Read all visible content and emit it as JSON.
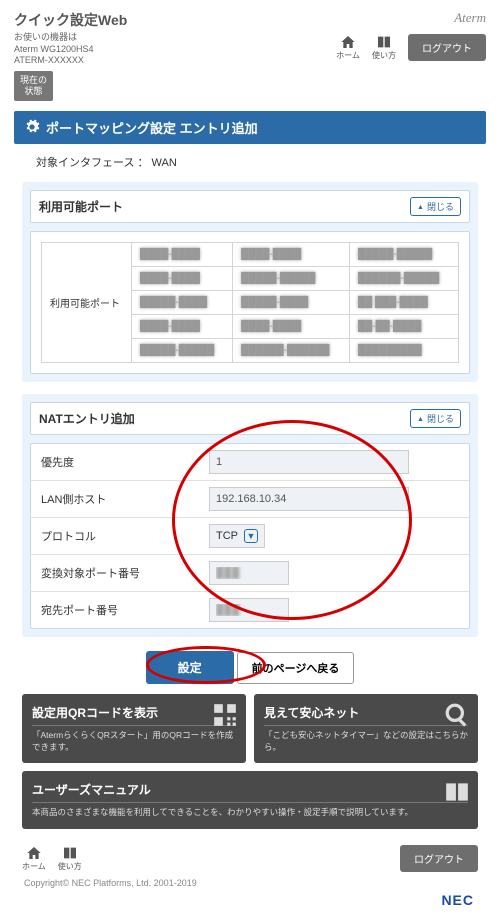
{
  "header": {
    "app_title": "クイック設定Web",
    "device_label": "お使いの機器は",
    "device_model": "Aterm WG1200HS4",
    "device_id": "ATERM-XXXXXX",
    "brand": "Aterm",
    "status_badge": "現在の\n状態",
    "nav_home": "ホーム",
    "nav_guide": "使い方",
    "logout": "ログアウト"
  },
  "page": {
    "title": "ポートマッピング設定 エントリ追加",
    "iface_label": "対象インタフェース ： WAN"
  },
  "panel_available": {
    "title": "利用可能ポート",
    "toggle": "閉じる",
    "row_label": "利用可能ポート",
    "cells": [
      [
        "████-████",
        "████-████",
        "█████-█████"
      ],
      [
        "████-████",
        "█████-█████",
        "██████-█████"
      ],
      [
        "█████-████",
        "█████-████",
        "██ ███-████"
      ],
      [
        "████-████",
        "████-████",
        "██-██-████"
      ],
      [
        "█████-█████",
        "██████-██████",
        "█████████"
      ]
    ]
  },
  "panel_nat": {
    "title": "NATエントリ追加",
    "toggle": "閉じる",
    "rows": {
      "priority_label": "優先度",
      "priority_value": "1",
      "lanhost_label": "LAN側ホスト",
      "lanhost_value": "192.168.10.34",
      "proto_label": "プロトコル",
      "proto_value": "TCP",
      "srcport_label": "変換対象ポート番号",
      "srcport_value": "███",
      "dstport_label": "宛先ポート番号",
      "dstport_value": "███"
    }
  },
  "buttons": {
    "submit": "設定",
    "back": "前のページへ戻る"
  },
  "cards": {
    "qr_title": "設定用QRコードを表示",
    "qr_desc": "「AtermらくらくQRスタート」用のQRコードを作成できます。",
    "safety_title": "見えて安心ネット",
    "safety_desc": "「こども安心ネットタイマー」などの設定はこちらから。",
    "manual_title": "ユーザーズマニュアル",
    "manual_desc": "本商品のさまざまな機能を利用してできることを、わかりやすい操作・設定手順で説明しています。"
  },
  "footer": {
    "copyright": "Copyright© NEC Platforms, Ltd. 2001-2019",
    "nec": "NEC"
  }
}
